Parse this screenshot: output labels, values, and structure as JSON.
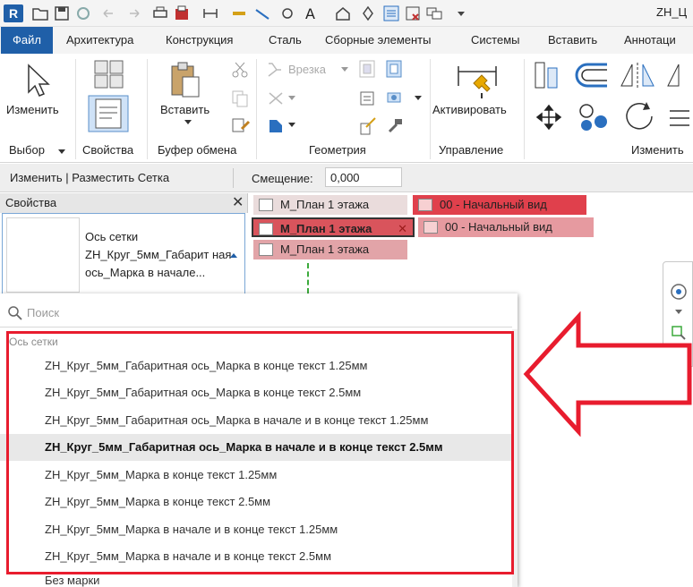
{
  "qat": {
    "logo": "R",
    "title": "ZH_Ц"
  },
  "tabs": [
    {
      "label": "Файл",
      "active": true
    },
    {
      "label": "Архитектура"
    },
    {
      "label": "Конструкция"
    },
    {
      "label": "Сталь"
    },
    {
      "label": "Сборные элементы"
    },
    {
      "label": "Системы"
    },
    {
      "label": "Вставить"
    },
    {
      "label": "Аннотаци"
    }
  ],
  "ribbon": {
    "modify_label": "Изменить",
    "paste_label": "Вставить",
    "cut_label": "Врезка",
    "activate_label": "Активировать",
    "panels": {
      "select": "Выбор",
      "properties": "Свойства",
      "clipboard": "Буфер обмена",
      "geometry": "Геометрия",
      "manage": "Управление",
      "modify": "Изменить"
    }
  },
  "optbar": {
    "context": "Изменить | Разместить Сетка",
    "offset_label": "Смещение:",
    "offset_value": "0,000"
  },
  "properties": {
    "title": "Свойства",
    "close": "✕",
    "type_name": "Ось сетки ZH_Круг_5мм_Габарит ная ось_Марка в начале..."
  },
  "view_tabs": [
    {
      "label": "М_План 1 этажа",
      "state": "inactive"
    },
    {
      "label": "00 - Начальный вид",
      "state": "red"
    },
    {
      "label": "М_План 1 этажа",
      "state": "active"
    },
    {
      "label": "00 - Начальный вид",
      "state": "pink"
    },
    {
      "label": "М_План 1 этажа",
      "state": "pink"
    }
  ],
  "dropdown": {
    "search_placeholder": "Поиск",
    "group_label": "Ось сетки",
    "options": [
      {
        "label": "ZH_Круг_5мм_Габаритная ось_Марка в конце текст 1.25мм"
      },
      {
        "label": "ZH_Круг_5мм_Габаритная ось_Марка в конце текст 2.5мм"
      },
      {
        "label": "ZH_Круг_5мм_Габаритная ось_Марка в начале и в конце текст 1.25мм"
      },
      {
        "label": "ZH_Круг_5мм_Габаритная ось_Марка в начале и в конце текст 2.5мм",
        "selected": true
      },
      {
        "label": "ZH_Круг_5мм_Марка в конце текст 1.25мм"
      },
      {
        "label": "ZH_Круг_5мм_Марка в конце текст 2.5мм"
      },
      {
        "label": "ZH_Круг_5мм_Марка в начале и в конце текст 1.25мм"
      },
      {
        "label": "ZH_Круг_5мм_Марка в начале и в конце текст 2.5мм"
      },
      {
        "label": "Без марки"
      }
    ]
  },
  "colors": {
    "accent": "#1f5fa8",
    "annotation": "#e81c2e",
    "tab_red": "#e0404c",
    "tab_pink": "#e69aa0"
  }
}
